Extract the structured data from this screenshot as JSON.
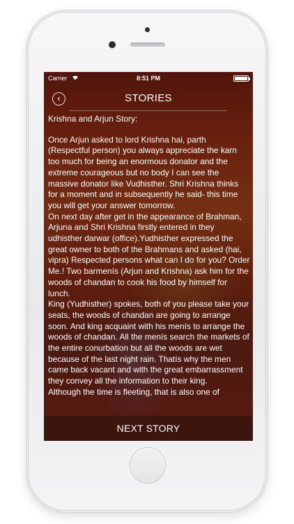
{
  "status_bar": {
    "carrier": "Carrier",
    "time": "8:51 PM",
    "wifi_icon": "wifi-icon",
    "battery_icon": "battery-icon"
  },
  "nav": {
    "back_icon": "chevron-left-icon",
    "back_glyph": "‹",
    "title": "STORIES"
  },
  "story": {
    "title": "Krishna and Arjun Story:",
    "body": "Once Arjun asked to lord Krishna hai, parth (Respectful person) you always appreciate the karn too much for being an enormous donator and the extreme courageous but no body I can see the massive donator like Vudhisther. Shri Krishna thinks for a moment and in subsequently he said- this time you will get your answer tomorrow.\nOn next day after get in the appearance of Brahman, Arjuna and Shri Krishna firstly entered in they udhisther darwar (office).Yudhisther expressed the great owner to both of the Brahmans and asked (hai, vipra) Respected persons what can I do for you? Order Me.! Two barmenís (Arjun and Krishna) ask him for the woods of chandan to cook his food by himself for lunch.\nKing (Yudhisther) spokes, both of you please take your seats, the woods of chandan are going to arrange soon. And king acquaint with his menís to arrange the woods of chandan. All the menís search the markets of the entire conurbation but all the woods are wet because of the last night rain. Thatís why the men came back vacant and with the great embarrassment they convey all the information to their king.\nAlthough the time is fleeting, that is also one of"
  },
  "footer": {
    "next_label": "NEXT STORY"
  }
}
